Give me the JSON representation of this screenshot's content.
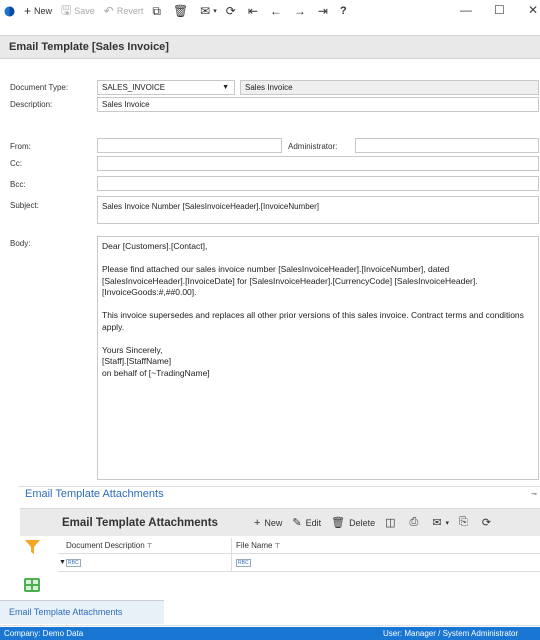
{
  "toolbar": {
    "new_label": "New",
    "save_label": "Save",
    "revert_label": "Revert",
    "help_label": "?"
  },
  "page_title": "Email Template [Sales Invoice]",
  "form": {
    "document_type_label": "Document Type:",
    "document_type_value": "SALES_INVOICE",
    "document_type_desc": "Sales Invoice",
    "description_label": "Description:",
    "description_value": "Sales Invoice",
    "from_label": "From:",
    "from_value": "",
    "administrator_label": "Administrator:",
    "administrator_value": "",
    "cc_label": "Cc:",
    "cc_value": "",
    "bcc_label": "Bcc:",
    "bcc_value": "",
    "subject_label": "Subject:",
    "subject_value": "Sales Invoice Number [SalesInvoiceHeader].[InvoiceNumber]",
    "body_label": "Body:",
    "body_lines": [
      "Dear [Customers].[Contact],",
      "Please find attached our sales invoice number [SalesInvoiceHeader].[InvoiceNumber], dated [SalesInvoiceHeader].[InvoiceDate] for [SalesInvoiceHeader].[CurrencyCode] [SalesInvoiceHeader].[InvoiceGoods:#,##0.00].",
      "This invoice supersedes and replaces all other prior versions of this sales invoice. Contract terms and conditions apply.",
      "Yours Sincerely,",
      "[Staff].[StaffName]",
      "on behalf of [~TradingName]"
    ]
  },
  "attachments": {
    "section_tab": "Email Template Attachments",
    "grid_title": "Email Template Attachments",
    "new_label": "New",
    "edit_label": "Edit",
    "delete_label": "Delete",
    "columns": [
      "Document Description",
      "File Name"
    ],
    "filter_placeholder": "RBC",
    "bottom_tab": "Email Template Attachments"
  },
  "status": {
    "company": "Company: Demo Data",
    "user": "User: Manager / System Administrator"
  },
  "colors": {
    "accent": "#1976d2",
    "link": "#2f6dbf",
    "filter_funnel": "#f5a623",
    "grid_icon": "#4caf50"
  }
}
